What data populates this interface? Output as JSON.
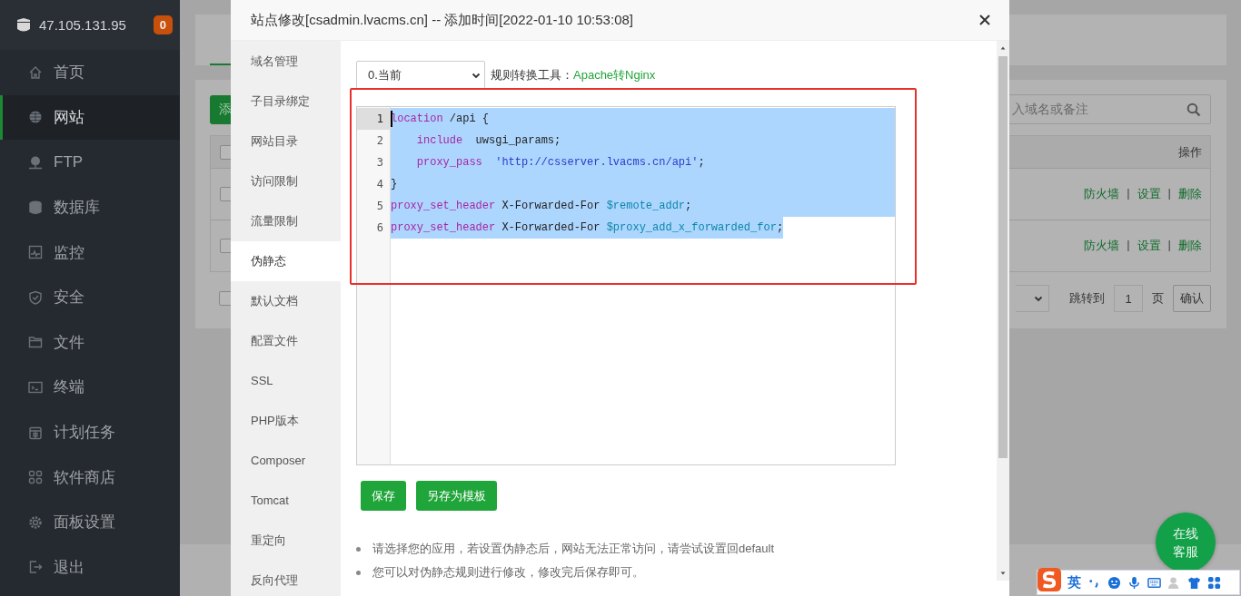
{
  "sidebar": {
    "host": "47.105.131.95",
    "badge": "0",
    "items": [
      {
        "label": "首页",
        "selected": false
      },
      {
        "label": "网站",
        "selected": true
      },
      {
        "label": "FTP",
        "selected": false
      },
      {
        "label": "数据库",
        "selected": false
      },
      {
        "label": "监控",
        "selected": false
      },
      {
        "label": "安全",
        "selected": false
      },
      {
        "label": "文件",
        "selected": false
      },
      {
        "label": "终端",
        "selected": false
      },
      {
        "label": "计划任务",
        "selected": false
      },
      {
        "label": "软件商店",
        "selected": false
      },
      {
        "label": "面板设置",
        "selected": false
      },
      {
        "label": "退出",
        "selected": false
      }
    ]
  },
  "background_page": {
    "add_button": "添",
    "search": {
      "placeholder": "入域名或备注"
    },
    "table": {
      "action_header": "操作",
      "header_checked": false,
      "rows": [
        {
          "checked": false,
          "actions": [
            "防火墙",
            "|",
            "设置",
            "|",
            "删除"
          ]
        },
        {
          "checked": false,
          "actions": [
            "防火墙",
            "|",
            "设置",
            "|",
            "删除"
          ]
        }
      ]
    },
    "pagination": {
      "select_all_checked": false,
      "jump_label": "跳转到",
      "page_value": "1",
      "page_unit": "页",
      "confirm": "确认"
    }
  },
  "dialog": {
    "title": "站点修改[csadmin.lvacms.cn] -- 添加时间[2022-01-10 10:53:08]",
    "tabs": [
      {
        "label": "域名管理",
        "selected": false
      },
      {
        "label": "子目录绑定",
        "selected": false
      },
      {
        "label": "网站目录",
        "selected": false
      },
      {
        "label": "访问限制",
        "selected": false
      },
      {
        "label": "流量限制",
        "selected": false
      },
      {
        "label": "伪静态",
        "selected": true
      },
      {
        "label": "默认文档",
        "selected": false
      },
      {
        "label": "配置文件",
        "selected": false
      },
      {
        "label": "SSL",
        "selected": false
      },
      {
        "label": "PHP版本",
        "selected": false
      },
      {
        "label": "Composer",
        "selected": false
      },
      {
        "label": "Tomcat",
        "selected": false
      },
      {
        "label": "重定向",
        "selected": false
      },
      {
        "label": "反向代理",
        "selected": false
      }
    ],
    "template_select": "0.当前",
    "converter_label": "规则转换工具：",
    "converter_link": "Apache转Nginx",
    "editor": {
      "lines": [
        {
          "number": "1",
          "cursor": true,
          "selected": true,
          "tokens": [
            {
              "kind": "keyword",
              "text": "location"
            },
            {
              "kind": "plain",
              "text": " /api {"
            }
          ]
        },
        {
          "number": "2",
          "cursor": false,
          "selected": true,
          "indented": true,
          "tokens": [
            {
              "kind": "keyword",
              "text": "include"
            },
            {
              "kind": "plain",
              "text": "  uwsgi_params;"
            }
          ]
        },
        {
          "number": "3",
          "cursor": false,
          "selected": true,
          "indented": true,
          "tokens": [
            {
              "kind": "keyword",
              "text": "proxy_pass"
            },
            {
              "kind": "string",
              "text": "  'http://csserver.lvacms.cn/api'"
            },
            {
              "kind": "plain",
              "text": ";"
            }
          ]
        },
        {
          "number": "4",
          "cursor": false,
          "selected": true,
          "tokens": [
            {
              "kind": "plain",
              "text": "}"
            }
          ]
        },
        {
          "number": "5",
          "cursor": false,
          "selected": true,
          "tokens": [
            {
              "kind": "keyword",
              "text": "proxy_set_header"
            },
            {
              "kind": "plain",
              "text": " X-Forwarded-For "
            },
            {
              "kind": "variable",
              "text": "$remote_addr"
            },
            {
              "kind": "plain",
              "text": ";"
            }
          ]
        },
        {
          "number": "6",
          "cursor": false,
          "selected": true,
          "tokens": [
            {
              "kind": "keyword",
              "text": "proxy_set_header"
            },
            {
              "kind": "plain",
              "text": " X-Forwarded-For "
            },
            {
              "kind": "variable",
              "text": "$proxy_add_x_forwarded_for"
            },
            {
              "kind": "plain",
              "text": ";"
            }
          ]
        }
      ]
    },
    "buttons": [
      "保存",
      "另存为模板"
    ],
    "notes": [
      "请选择您的应用，若设置伪静态后，网站无法正常访问，请尝试设置回default",
      "您可以对伪静态规则进行修改，修改完后保存即可。"
    ]
  },
  "chat_button": "在线客服",
  "ime_bar": {
    "language": "英"
  }
}
